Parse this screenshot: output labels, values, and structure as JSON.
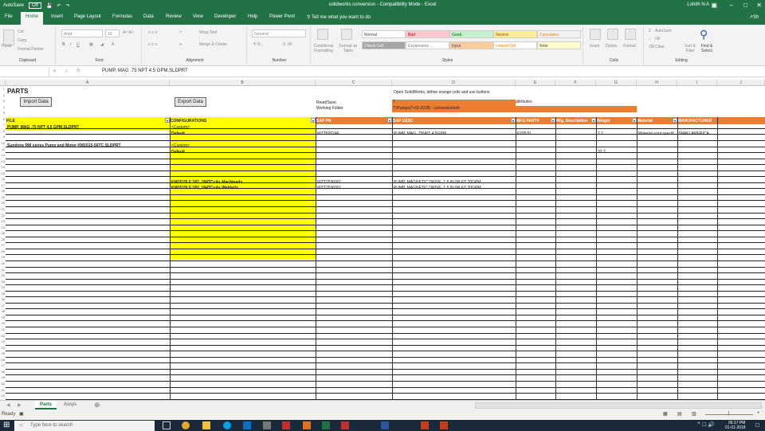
{
  "titlebar": {
    "autosave": "AutoSave",
    "autosave_state": "Off",
    "title": "solidworks conversion  -  Compatibility Mode  -  Excel",
    "user": "Lohith N A",
    "share": "Sh"
  },
  "tabs": [
    "File",
    "Home",
    "Insert",
    "Page Layout",
    "Formulas",
    "Data",
    "Review",
    "View",
    "Developer",
    "Help",
    "Power Pivot"
  ],
  "tell_me": "Tell me what you want to do",
  "ribbon": {
    "clipboard": {
      "label": "Clipboard",
      "paste": "Paste",
      "cut": "Cut",
      "copy": "Copy",
      "format_painter": "Format Painter"
    },
    "font": {
      "label": "Font",
      "name": "Arial",
      "size": "10"
    },
    "alignment": {
      "label": "Alignment",
      "wrap": "Wrap Text",
      "merge": "Merge & Center"
    },
    "number": {
      "label": "Number",
      "format": "General"
    },
    "styles": {
      "label": "Styles",
      "cond": "Conditional Formatting",
      "table": "Format as Table",
      "cells": [
        "Normal",
        "Bad",
        "Good",
        "Neutral",
        "Calculation",
        "Check Cell",
        "Explanatory ...",
        "Input",
        "Linked Cell",
        "Note"
      ]
    },
    "cells": {
      "label": "Cells",
      "insert": "Insert",
      "delete": "Delete",
      "format": "Format"
    },
    "editing": {
      "label": "Editing",
      "autosum": "AutoSum",
      "fill": "Fill",
      "clear": "Clear",
      "sort": "Sort & Filter",
      "find": "Find & Select"
    }
  },
  "formula_bar": {
    "name_box": "",
    "formula": "PUMP, MAG .75 NPT 4.5 GPM.SLDPRT"
  },
  "columns": [
    "A",
    "B",
    "C",
    "D",
    "E",
    "F",
    "G",
    "H",
    "I",
    "J"
  ],
  "row_numbers": [
    "1",
    "2",
    "3",
    "4",
    "5",
    "6",
    "7",
    "8",
    "9",
    "10",
    "11",
    "12",
    "13",
    "14",
    "15",
    "16",
    "17",
    "18",
    "19",
    "20",
    "21",
    "22",
    "23",
    "24",
    "25",
    "26",
    "27",
    "28",
    "29",
    "30",
    "31",
    "32",
    "33",
    "34",
    "35",
    "36",
    "37",
    "38",
    "39",
    "40",
    "41",
    "42",
    "43",
    "44",
    "45",
    "46",
    "47",
    "48",
    "49",
    "50",
    "51",
    "52",
    "53",
    "54",
    "55",
    "56",
    "57",
    "58",
    "59",
    "60"
  ],
  "sheet": {
    "parts_title": "PARTS",
    "import_button": "Import Data",
    "export_button": "Export Data",
    "note": "Open SolidWorks, define orange cells and use buttons",
    "read_save": "Read/Save",
    "working_folder": "Working Folder",
    "read_save_value": "7",
    "working_folder_value": "T:\\Pumps(7-03-2018) - conversion\\mfi",
    "attributes": "attributes",
    "headers": {
      "file": "FILE",
      "config": "CONFIGURATIONS",
      "sap_pn": "SAP PN",
      "sap_desc": "SAP DESC",
      "mfg_part": "MFG PART#",
      "mfg_desc": "Mfg. Description",
      "weight": "Weight",
      "material": "Material",
      "manufacturer": "MANUFACTURER"
    },
    "rows": [
      {
        "file": "PUMP, MAG .75 NPT 4.5 GPM.SLDPRT",
        "config": "<Custom>",
        "sap": "",
        "desc": "",
        "mfg": "",
        "weight": "",
        "material": "",
        "manu": ""
      },
      {
        "file": "",
        "config": "Default",
        "sap": "WZT820746",
        "desc": "PUMP, MAG .75NPT 4.5GPM",
        "mfg": "F20570",
        "weight": "7.7",
        "material": "Material <not specifi",
        "manu": "IWAKI AMERICA"
      },
      {
        "file": "Sundyne RM series Pump and Motor KM1515-56TC.SLDPRT",
        "config": "<Custom>",
        "sap": "",
        "desc": "",
        "mfg": "",
        "weight": "",
        "material": "",
        "manu": ""
      },
      {
        "file": "",
        "config": "Default",
        "sap": "",
        "desc": "",
        "mfg": "",
        "weight": "32.2",
        "material": "",
        "manu": ""
      },
      {
        "file": "",
        "config": "KM1515LF 182_184TC<As Machined>",
        "sap": "WZT2536001",
        "desc": "PUMP, MAGNETIC DRIVE, 1.5 IN INLET 20GPM",
        "mfg": "",
        "weight": "",
        "material": "",
        "manu": ""
      },
      {
        "file": "",
        "config": "KM1515LF 182_184TC<As Welded>",
        "sap": "WZT2536001",
        "desc": "PUMP, MAGNETIC DRIVE, 1.5 IN INLET 20GPM",
        "mfg": "",
        "weight": "",
        "material": "",
        "manu": ""
      }
    ]
  },
  "sheet_tabs": [
    "Parts",
    "Assys"
  ],
  "status": {
    "ready": "Ready"
  },
  "taskbar": {
    "search": "Type here to search",
    "time": "06:17 PM",
    "date": "01-01-2018"
  },
  "colors": {
    "excel_green": "#217346",
    "header_yellow": "#ffff00",
    "header_orange": "#ed7d31",
    "taskbar": "#1b2a3a"
  }
}
